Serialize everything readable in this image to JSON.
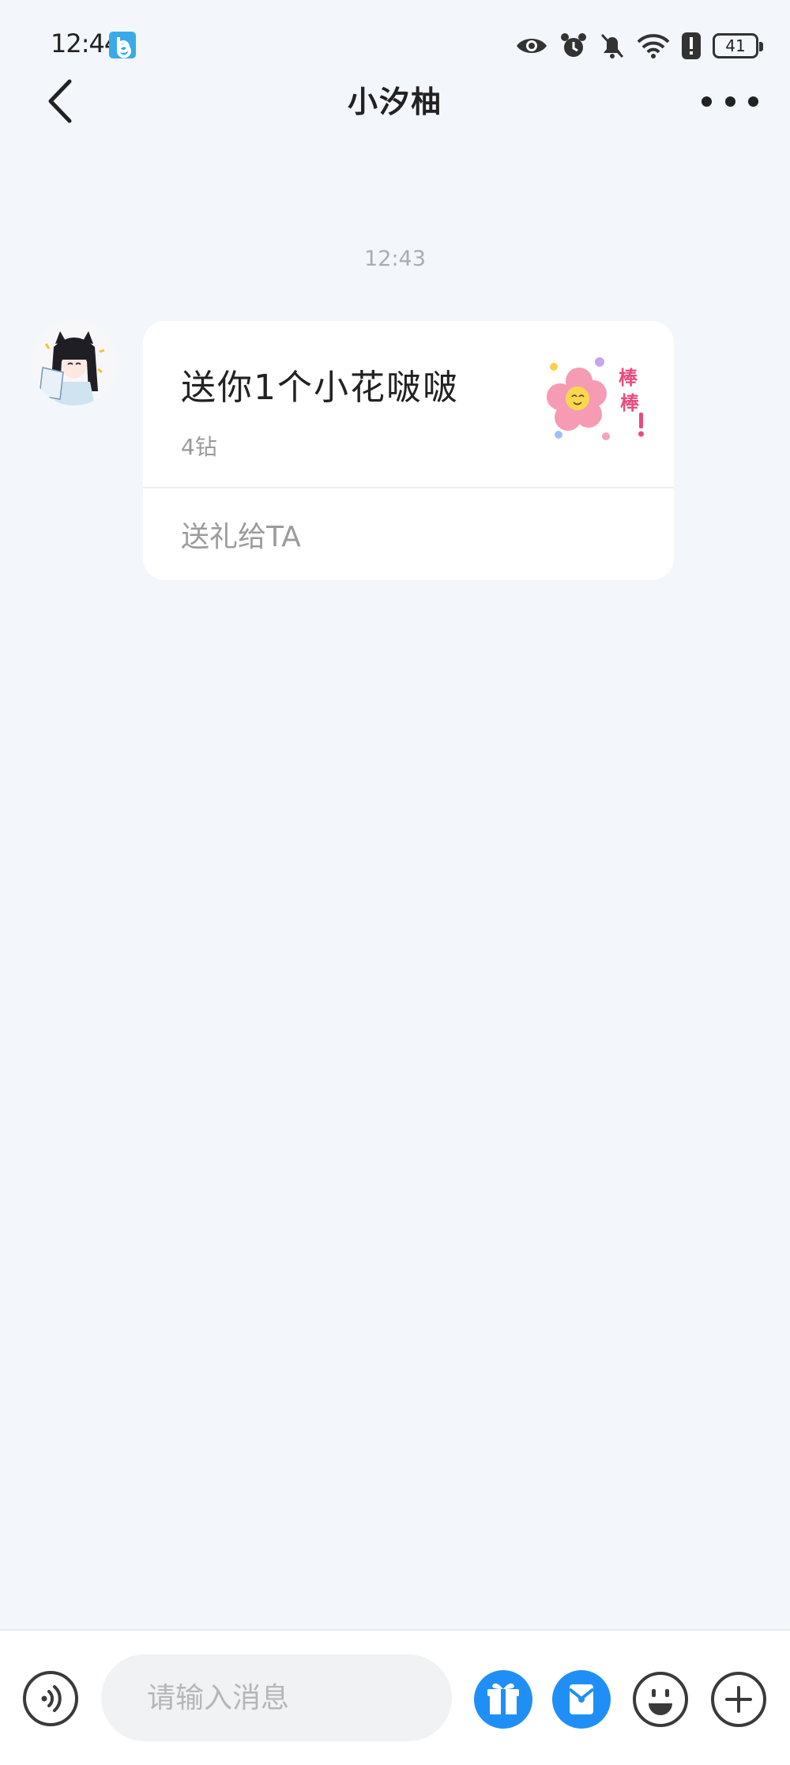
{
  "status_bar": {
    "time": "12:44",
    "battery": "41"
  },
  "header": {
    "title": "小汐柚"
  },
  "conversation": {
    "timestamp": "12:43",
    "gift_message": {
      "text": "送你1个小花啵啵",
      "price": "4钻",
      "action_label": "送礼给TA"
    }
  },
  "composer": {
    "placeholder": "请输入消息"
  },
  "icons": {
    "back": "chevron-left-icon",
    "more": "more-dots-icon",
    "voice": "voice-icon",
    "gift": "gift-icon",
    "red_packet": "red-packet-icon",
    "emoji": "emoji-icon",
    "plus": "plus-icon"
  },
  "colors": {
    "accent": "#1f8ff5",
    "background": "#f3f6fa"
  }
}
